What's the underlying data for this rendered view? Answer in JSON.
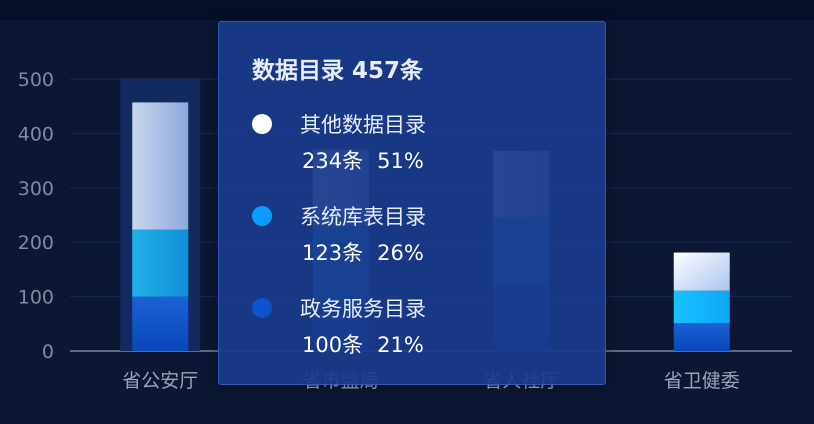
{
  "chart_data": {
    "type": "bar",
    "stacked": true,
    "categories": [
      "省公安厅",
      "省市监局",
      "省人社厅",
      "省卫健委"
    ],
    "series": [
      {
        "name": "政务服务目录",
        "values": [
          100,
          90,
          124,
          51
        ],
        "color": "#1d5fd0"
      },
      {
        "name": "系统库表目录",
        "values": [
          123,
          140,
          122,
          60
        ],
        "color": "#1aa0e6"
      },
      {
        "name": "其他数据目录",
        "values": [
          234,
          140,
          122,
          70
        ],
        "color": "#b9c9e6"
      }
    ],
    "highlight_category": "省公安厅",
    "ylim": [
      0,
      500
    ],
    "yticks": [
      0,
      100,
      200,
      300,
      400,
      500
    ],
    "grid": true,
    "title": "",
    "xlabel": "",
    "ylabel": ""
  },
  "tooltip": {
    "title": "数据目录 457条",
    "items": [
      {
        "name": "其他数据目录",
        "count": "234条",
        "percent": "51%",
        "color": "#ffffff"
      },
      {
        "name": "系统库表目录",
        "count": "123条",
        "percent": "26%",
        "color": "#0b9cff"
      },
      {
        "name": "政务服务目录",
        "count": "100条",
        "percent": "21%",
        "color": "#0d53c9"
      }
    ]
  }
}
